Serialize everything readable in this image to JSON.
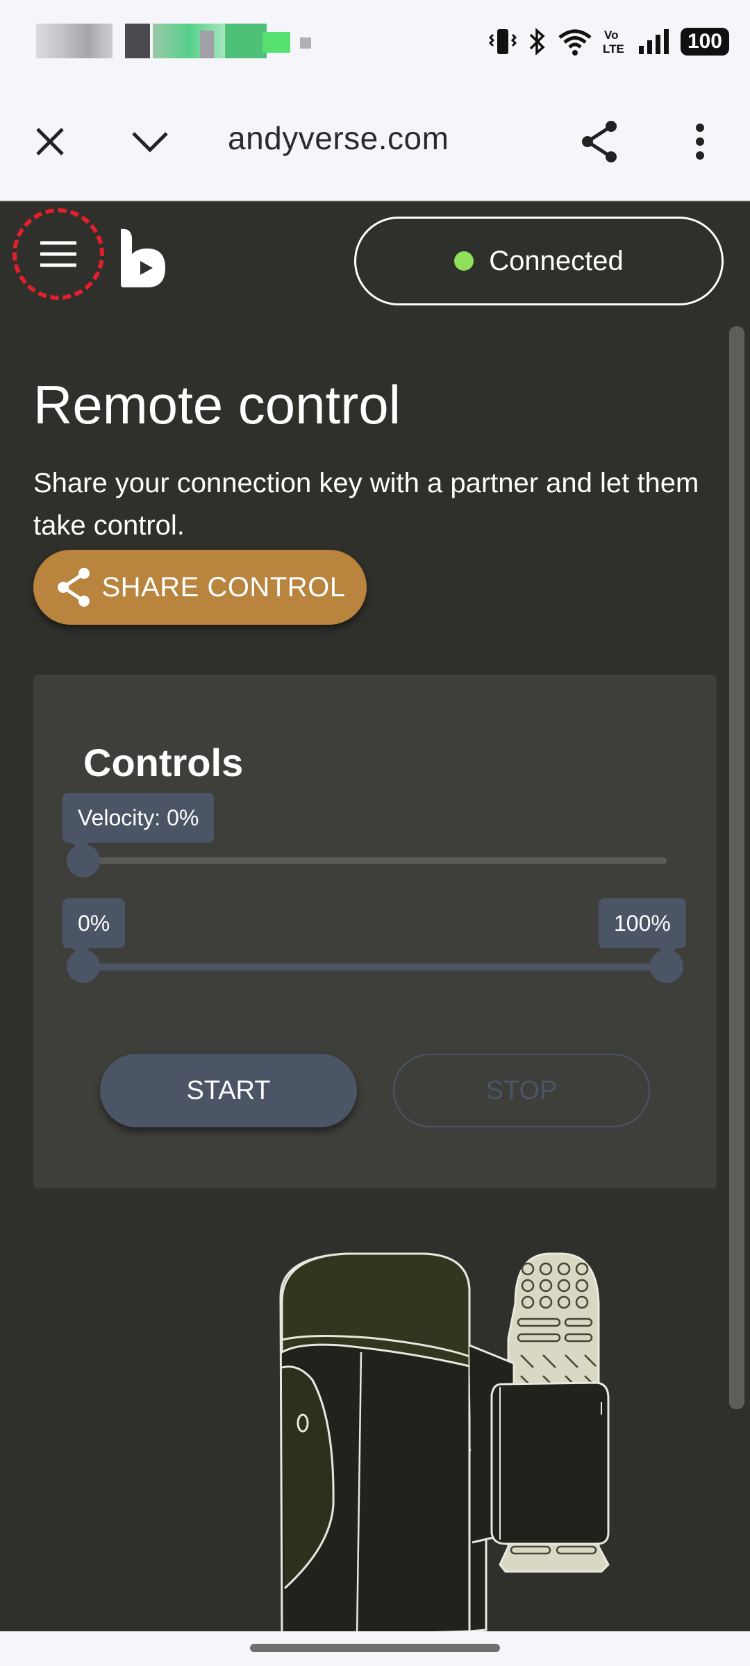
{
  "status_bar": {
    "battery": "100",
    "network_label": "Vo LTE",
    "icons": [
      "vibrate-icon",
      "bluetooth-icon",
      "wifi-icon",
      "volte-icon",
      "signal-icon",
      "battery-icon"
    ]
  },
  "browser": {
    "url": "andyverse.com",
    "icons": [
      "close-icon",
      "chevron-down-icon",
      "share-icon",
      "more-vert-icon"
    ]
  },
  "header": {
    "status_label": "Connected",
    "status_color": "#8fe05a"
  },
  "page": {
    "title": "Remote control",
    "description": "Share your connection key with a partner and let them take control.",
    "share_button": "SHARE CONTROL"
  },
  "controls": {
    "title": "Controls",
    "velocity_label": "Velocity: 0%",
    "velocity_value": 0,
    "range_min_label": "0%",
    "range_max_label": "100%",
    "range_min": 0,
    "range_max": 100,
    "start_label": "START",
    "stop_label": "STOP"
  },
  "colors": {
    "accent": "#b8843e",
    "control": "#4b5566",
    "background": "#2f2f2b",
    "card": "#3e3e3a"
  }
}
